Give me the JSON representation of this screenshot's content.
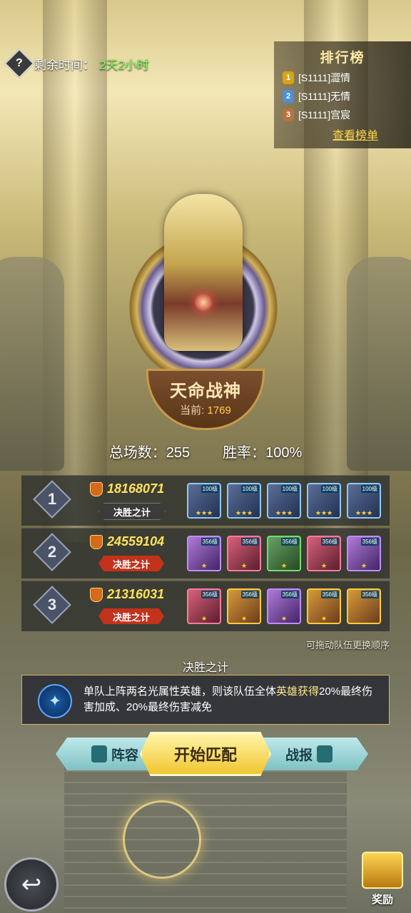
{
  "timer": {
    "label": "剩余时间：",
    "value": "2天2小时"
  },
  "leaderboard": {
    "title": "排行榜",
    "entries": [
      {
        "rank": "1",
        "name": "[S1111]澀情"
      },
      {
        "rank": "2",
        "name": "[S1111]无情"
      },
      {
        "rank": "3",
        "name": "[S1111]宫宸"
      }
    ],
    "link": "查看榜单"
  },
  "emblem": {
    "title": "天命战神",
    "score_label": "当前:",
    "score_value": "1769"
  },
  "stats": {
    "matches": "总场数：255",
    "winrate": "胜率：100%"
  },
  "teams": [
    {
      "num": "1",
      "power": "18168071",
      "tactic": "决胜之计",
      "heroes": [
        {
          "level": "100级",
          "stars": "★★★"
        },
        {
          "level": "100级",
          "stars": "★★★"
        },
        {
          "level": "100级",
          "stars": "★★★"
        },
        {
          "level": "100级",
          "stars": "★★★"
        },
        {
          "level": "100级",
          "stars": "★★★"
        }
      ]
    },
    {
      "num": "2",
      "power": "24559104",
      "tactic": "决胜之计",
      "heroes": [
        {
          "level": "356级",
          "stars": "★"
        },
        {
          "level": "356级",
          "stars": "★"
        },
        {
          "level": "356级",
          "stars": "★"
        },
        {
          "level": "356级",
          "stars": "★"
        },
        {
          "level": "356级",
          "stars": "★"
        }
      ]
    },
    {
      "num": "3",
      "power": "21316031",
      "tactic": "决胜之计",
      "heroes": [
        {
          "level": "356级",
          "stars": "★"
        },
        {
          "level": "356级",
          "stars": "★"
        },
        {
          "level": "356级",
          "stars": "★"
        },
        {
          "level": "356级",
          "stars": "★"
        },
        {
          "level": "356级",
          "stars": ""
        }
      ]
    }
  ],
  "drag_hint": "可拖动队伍更换顺序",
  "tactic_section": {
    "title": "决胜之计",
    "desc_a": "单队上阵两名光属性英雄，则该队伍全体",
    "desc_b": "英雄获得",
    "desc_c": "20%最终伤害加成、20%最终伤害减免"
  },
  "actions": {
    "lineup": "阵容",
    "start": "开始匹配",
    "report": "战报"
  },
  "reward_label": "奖励",
  "icons": {
    "back": "back-arrow-icon",
    "help": "question-icon",
    "reward": "gift-box-icon"
  }
}
